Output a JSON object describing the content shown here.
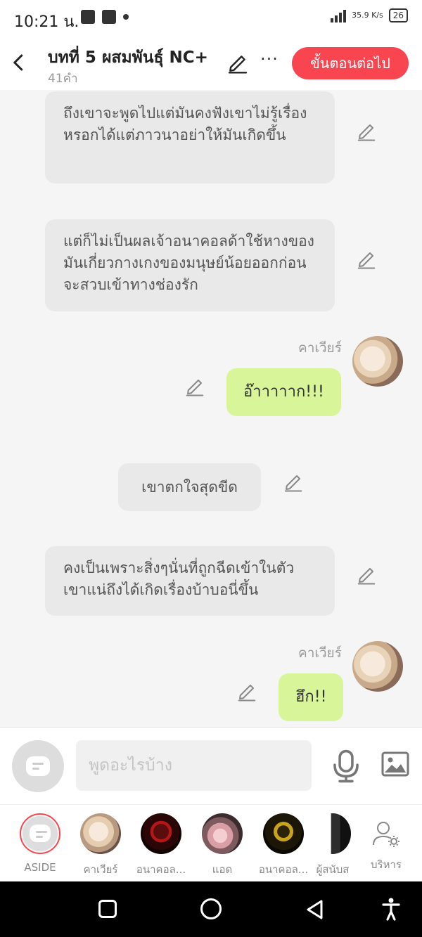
{
  "status_bar": {
    "time": "10:21 น.",
    "network_speed": "35.9 K/s",
    "network_type": "4G",
    "battery": "26"
  },
  "header": {
    "title": "บทที่ 5 ผสมพันธุ์ NC+",
    "word_count": "41คำ",
    "more_label": "···",
    "next_button": "ขั้นตอนต่อไป"
  },
  "messages": [
    {
      "type": "narration",
      "text": "ถึงเขาจะพูดไปแต่มันคงฟังเขาไม่รู้เรื่องหรอกได้แต่ภาวนาอย่าให้มันเกิดขึ้น"
    },
    {
      "type": "narration",
      "text": "แต่ก็ไม่เป็นผลเจ้าอนาคอลด้าใช้หางของมันเกี่ยวกางเกงของมนุษย์น้อยออกก่อนจะสวบเข้าทางช่องรัก"
    },
    {
      "type": "dialogue",
      "sender": "คาเวียร์",
      "text": "อ๊าาาาาก!!!"
    },
    {
      "type": "narration",
      "text": "เขาตกใจสุดขีด"
    },
    {
      "type": "narration",
      "text": "คงเป็นเพราะสิ่งๆนั่นที่ถูกฉีดเข้าในตัวเขาแน่ถึงได้เกิดเรื่องบ้าบอนี่ขึ้น"
    },
    {
      "type": "dialogue",
      "sender": "คาเวียร์",
      "text": "ฮึก!!"
    }
  ],
  "input": {
    "placeholder": "พูดอะไรบ้าง",
    "icons": [
      "chat-bubble-icon",
      "microphone-icon",
      "image-icon"
    ]
  },
  "characters": [
    {
      "name": "ASIDE",
      "selected": true
    },
    {
      "name": "คาเวียร์"
    },
    {
      "name": "อนาคอล..."
    },
    {
      "name": "แอด"
    },
    {
      "name": "อนาคอล..."
    },
    {
      "name": "ผู้สนับส"
    },
    {
      "name": "บริหาร"
    }
  ],
  "colors": {
    "accent": "#f9454f",
    "dialogue_bubble": "#d9f59a",
    "narration_bubble": "#e9e9e9"
  }
}
